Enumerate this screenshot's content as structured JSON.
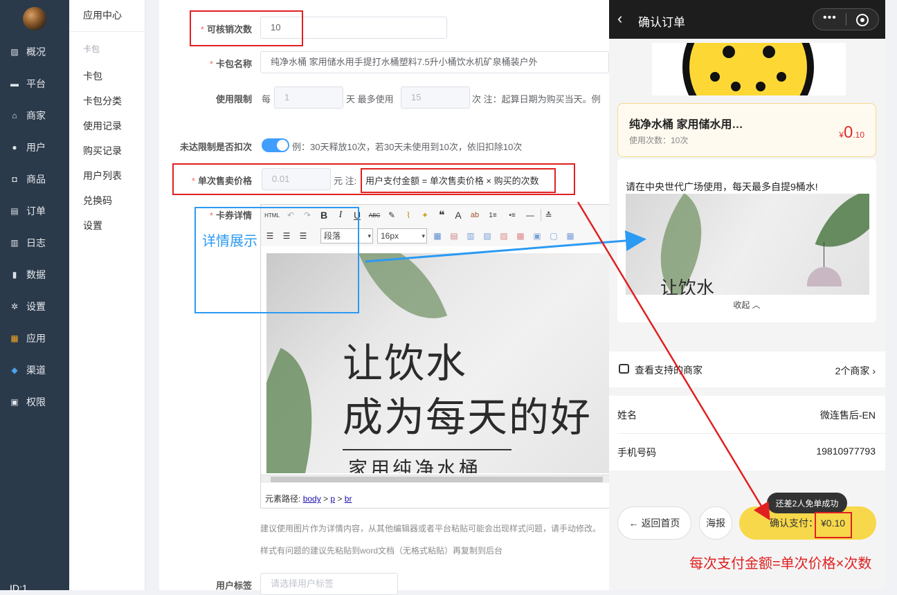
{
  "sidebar": {
    "items": [
      {
        "label": "概况",
        "icon": "chart-icon"
      },
      {
        "label": "平台",
        "icon": "monitor-icon"
      },
      {
        "label": "商家",
        "icon": "store-icon"
      },
      {
        "label": "用户",
        "icon": "user-icon"
      },
      {
        "label": "商品",
        "icon": "bag-icon"
      },
      {
        "label": "订单",
        "icon": "order-icon"
      },
      {
        "label": "日志",
        "icon": "book-icon"
      },
      {
        "label": "数据",
        "icon": "bar-icon"
      },
      {
        "label": "设置",
        "icon": "gear-icon"
      },
      {
        "label": "应用",
        "icon": "apps-icon"
      },
      {
        "label": "渠道",
        "icon": "cube-icon"
      },
      {
        "label": "权限",
        "icon": "lock-icon"
      }
    ],
    "user_id": "ID:1"
  },
  "subnav": {
    "title": "应用中心",
    "group": "卡包",
    "items": [
      "卡包",
      "卡包分类",
      "使用记录",
      "购买记录",
      "用户列表",
      "兑换码",
      "设置"
    ]
  },
  "form": {
    "verify_times": {
      "label": "可核销次数",
      "value": "10"
    },
    "card_name": {
      "label": "卡包名称",
      "value": "纯净水桶 家用储水用手提打水桶塑料7.5升小桶饮水机矿泉桶装户外"
    },
    "usage_limit": {
      "label": "使用限制",
      "prefix": "每",
      "days": "1",
      "mid": "天 最多使用",
      "max": "15",
      "suffix": "次 注：起算日期为购买当天。例"
    },
    "deduct": {
      "label": "未达限制是否扣次",
      "on": true,
      "note": "例：30天释放10次，若30天未使用到10次，依旧扣除10次"
    },
    "unit_price": {
      "label": "单次售卖价格",
      "value": "0.01",
      "unit": "元 注:",
      "note": "用户支付金额 = 单次售卖价格 × 购买的次数"
    },
    "detail": {
      "label": "卡券详情"
    },
    "user_tag": {
      "label": "用户标签",
      "placeholder": "请选择用户标签"
    }
  },
  "editor": {
    "toolbar_row1": [
      "HTML",
      "↶",
      "↷",
      "B",
      "I",
      "U",
      "ABC",
      "✎",
      "🖌",
      "✦",
      "❝",
      "A",
      "ab",
      "1≡",
      "•≡",
      "—",
      "≛"
    ],
    "paragraph": "段落",
    "font_size": "16px",
    "image_text": {
      "line1": "让饮水",
      "line2": "成为每天的好",
      "line3": "家用纯净水桶"
    },
    "path_label": "元素路径:",
    "path": [
      "body",
      "p",
      "br"
    ],
    "hint1": "建议使用图片作为详情内容，从其他编辑器或者平台粘贴可能会出现样式问题，请手动修改。",
    "hint2": "样式有问题的建议先粘贴到word文档（无格式粘贴）再复制到后台"
  },
  "annotations": {
    "detail_show": "详情展示",
    "formula": "每次支付金额=单次价格×次数",
    "accent_red": "#e02020",
    "accent_blue": "#2b9af3"
  },
  "phone": {
    "title": "确认订单",
    "product": {
      "name": "纯净水桶 家用储水用…",
      "usage": "使用次数：10次",
      "price_sym": "¥",
      "price_int": "0",
      "price_dec": ".10"
    },
    "desc": "请在中央世代广场使用，每天最多自提9桶水!",
    "desc_img_text": "让饮水",
    "collapse": "收起",
    "merchant": {
      "label": "查看支持的商家",
      "count": "2个商家"
    },
    "name_row": {
      "label": "姓名",
      "value": "微连售后-EN"
    },
    "phone_row": {
      "label": "手机号码",
      "value": "19810977793"
    },
    "tip": "还差2人免单成功",
    "btn_home": "返回首页",
    "btn_poster": "海报",
    "btn_pay": "确认支付：",
    "pay_amount": "¥0.10"
  }
}
